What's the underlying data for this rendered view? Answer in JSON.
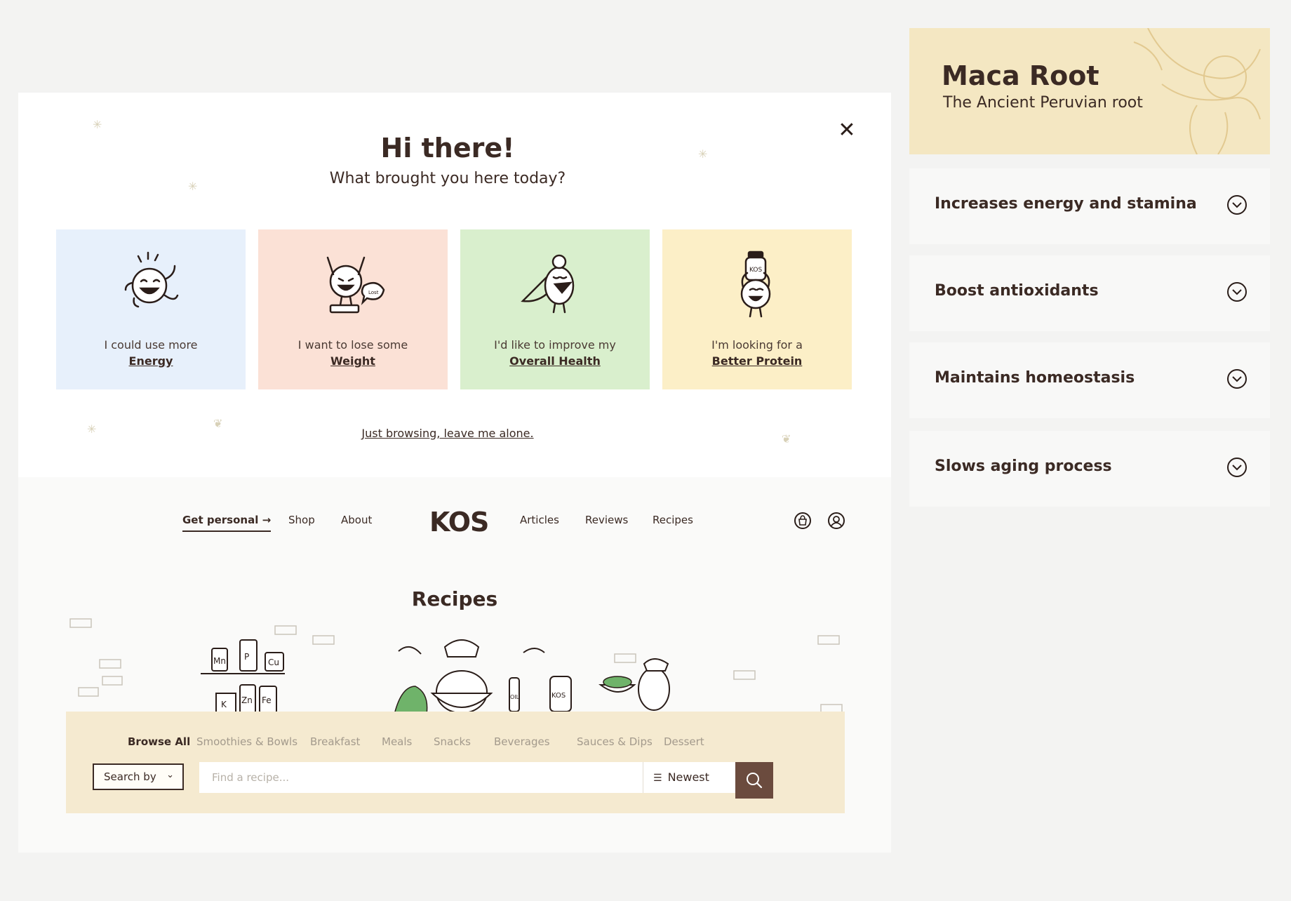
{
  "modal": {
    "title": "Hi there!",
    "subtitle": "What brought you here today?",
    "close_glyph": "✕",
    "cards": [
      {
        "line1": "I could use more",
        "line2": "Energy",
        "bg": "#e7f0fb",
        "icon": "energy-character-icon"
      },
      {
        "line1": "I want to lose some",
        "line2": "Weight",
        "bg": "#fbe1d6",
        "icon": "weight-character-icon"
      },
      {
        "line1": "I'd like to improve my",
        "line2": "Overall Health",
        "bg": "#d9efcd",
        "icon": "health-character-icon"
      },
      {
        "line1": "I'm looking for a",
        "line2": "Better Protein",
        "bg": "#fcefc7",
        "icon": "protein-character-icon"
      }
    ],
    "dismiss_link": "Just browsing, leave me alone."
  },
  "nav": {
    "left": [
      "Get personal →",
      "Shop",
      "About"
    ],
    "logo": "KOS",
    "right": [
      "Articles",
      "Reviews",
      "Recipes"
    ],
    "icons": [
      "shopping-bag-icon",
      "user-account-icon"
    ]
  },
  "recipes": {
    "title": "Recipes",
    "categories": [
      "Browse All",
      "Smoothies & Bowls",
      "Breakfast",
      "Meals",
      "Snacks",
      "Beverages",
      "Sauces & Dips",
      "Dessert"
    ],
    "search_by_label": "Search by",
    "search_placeholder": "Find a recipe...",
    "sort_label": "Newest",
    "scene_labels": [
      "Mn",
      "P",
      "Cu",
      "K",
      "Zn",
      "Fe",
      "OIL",
      "KOS"
    ]
  },
  "sidebar": {
    "title": "Maca Root",
    "tagline": "The Ancient Peruvian root",
    "items": [
      "Increases energy and stamina",
      "Boost antioxidants",
      "Maintains homeostasis",
      "Slows aging process"
    ]
  },
  "colors": {
    "brand_brown": "#6b4b3e",
    "text": "#3b2a24",
    "cream": "#f5ead0",
    "hero": "#f4e7c2"
  }
}
